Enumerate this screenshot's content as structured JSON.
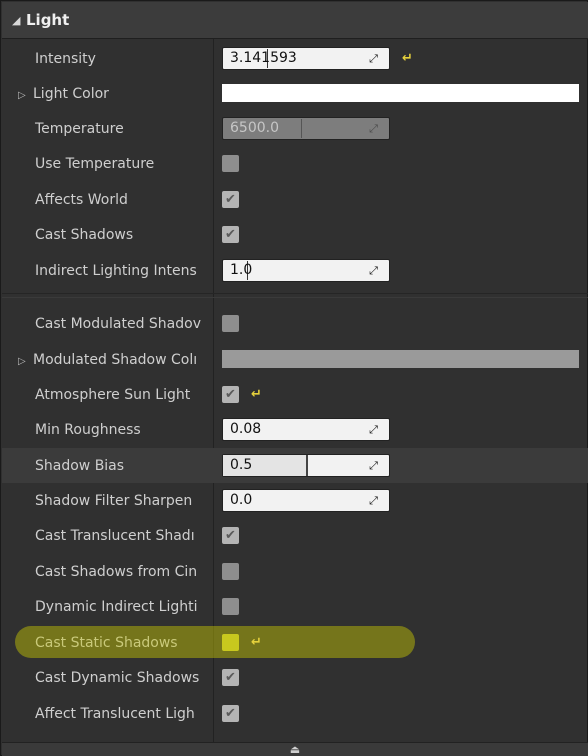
{
  "section": {
    "title": "Light",
    "collapse_icon": "triangle-down-icon"
  },
  "rows": {
    "intensity": {
      "label": "Intensity",
      "value": "3.141593"
    },
    "light_color": {
      "label": "Light Color",
      "color": "#ffffff"
    },
    "temperature": {
      "label": "Temperature",
      "value": "6500.0"
    },
    "use_temperature": {
      "label": "Use Temperature",
      "checked": false
    },
    "affects_world": {
      "label": "Affects World",
      "checked": true
    },
    "cast_shadows": {
      "label": "Cast Shadows",
      "checked": true
    },
    "indirect_lighting": {
      "label": "Indirect Lighting Intens",
      "value": "1.0"
    },
    "cast_modulated": {
      "label": "Cast Modulated Shadov",
      "checked": false
    },
    "modulated_color": {
      "label": "Modulated Shadow Colı",
      "color": "#9a9a9a"
    },
    "atmosphere_sun": {
      "label": "Atmosphere Sun Light",
      "checked": true
    },
    "min_roughness": {
      "label": "Min Roughness",
      "value": "0.08"
    },
    "shadow_bias": {
      "label": "Shadow Bias",
      "value": "0.5",
      "fill": 0.5
    },
    "shadow_filter": {
      "label": "Shadow Filter Sharpen",
      "value": "0.0"
    },
    "cast_translucent": {
      "label": "Cast Translucent Shadı",
      "checked": true
    },
    "cast_shadows_cin": {
      "label": "Cast Shadows from Cin",
      "checked": false
    },
    "dynamic_indirect": {
      "label": "Dynamic Indirect Lighti",
      "checked": false
    },
    "cast_static": {
      "label": "Cast Static Shadows",
      "checked": false,
      "highlighted": true
    },
    "cast_dynamic": {
      "label": "Cast Dynamic Shadows",
      "checked": true
    },
    "affect_translucent": {
      "label": "Affect Translucent Ligh",
      "checked": true
    }
  },
  "glyphs": {
    "check": "✔",
    "reset": "↵",
    "spin": "⤢",
    "expand": "▷",
    "collapse": "◢",
    "eject": "⏏"
  },
  "colors": {
    "highlight": "#d6d600",
    "panel": "#303030"
  }
}
